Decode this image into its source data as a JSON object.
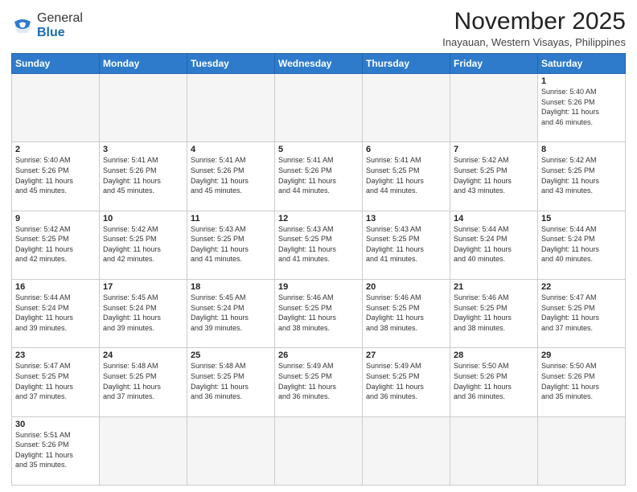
{
  "header": {
    "logo": {
      "general": "General",
      "blue": "Blue"
    },
    "title": "November 2025",
    "location": "Inayauan, Western Visayas, Philippines"
  },
  "days_of_week": [
    "Sunday",
    "Monday",
    "Tuesday",
    "Wednesday",
    "Thursday",
    "Friday",
    "Saturday"
  ],
  "weeks": [
    [
      {
        "day": null,
        "info": null
      },
      {
        "day": null,
        "info": null
      },
      {
        "day": null,
        "info": null
      },
      {
        "day": null,
        "info": null
      },
      {
        "day": null,
        "info": null
      },
      {
        "day": null,
        "info": null
      },
      {
        "day": "1",
        "info": "Sunrise: 5:40 AM\nSunset: 5:26 PM\nDaylight: 11 hours\nand 46 minutes."
      }
    ],
    [
      {
        "day": "2",
        "info": "Sunrise: 5:40 AM\nSunset: 5:26 PM\nDaylight: 11 hours\nand 45 minutes."
      },
      {
        "day": "3",
        "info": "Sunrise: 5:41 AM\nSunset: 5:26 PM\nDaylight: 11 hours\nand 45 minutes."
      },
      {
        "day": "4",
        "info": "Sunrise: 5:41 AM\nSunset: 5:26 PM\nDaylight: 11 hours\nand 45 minutes."
      },
      {
        "day": "5",
        "info": "Sunrise: 5:41 AM\nSunset: 5:26 PM\nDaylight: 11 hours\nand 44 minutes."
      },
      {
        "day": "6",
        "info": "Sunrise: 5:41 AM\nSunset: 5:25 PM\nDaylight: 11 hours\nand 44 minutes."
      },
      {
        "day": "7",
        "info": "Sunrise: 5:42 AM\nSunset: 5:25 PM\nDaylight: 11 hours\nand 43 minutes."
      },
      {
        "day": "8",
        "info": "Sunrise: 5:42 AM\nSunset: 5:25 PM\nDaylight: 11 hours\nand 43 minutes."
      }
    ],
    [
      {
        "day": "9",
        "info": "Sunrise: 5:42 AM\nSunset: 5:25 PM\nDaylight: 11 hours\nand 42 minutes."
      },
      {
        "day": "10",
        "info": "Sunrise: 5:42 AM\nSunset: 5:25 PM\nDaylight: 11 hours\nand 42 minutes."
      },
      {
        "day": "11",
        "info": "Sunrise: 5:43 AM\nSunset: 5:25 PM\nDaylight: 11 hours\nand 41 minutes."
      },
      {
        "day": "12",
        "info": "Sunrise: 5:43 AM\nSunset: 5:25 PM\nDaylight: 11 hours\nand 41 minutes."
      },
      {
        "day": "13",
        "info": "Sunrise: 5:43 AM\nSunset: 5:25 PM\nDaylight: 11 hours\nand 41 minutes."
      },
      {
        "day": "14",
        "info": "Sunrise: 5:44 AM\nSunset: 5:24 PM\nDaylight: 11 hours\nand 40 minutes."
      },
      {
        "day": "15",
        "info": "Sunrise: 5:44 AM\nSunset: 5:24 PM\nDaylight: 11 hours\nand 40 minutes."
      }
    ],
    [
      {
        "day": "16",
        "info": "Sunrise: 5:44 AM\nSunset: 5:24 PM\nDaylight: 11 hours\nand 39 minutes."
      },
      {
        "day": "17",
        "info": "Sunrise: 5:45 AM\nSunset: 5:24 PM\nDaylight: 11 hours\nand 39 minutes."
      },
      {
        "day": "18",
        "info": "Sunrise: 5:45 AM\nSunset: 5:24 PM\nDaylight: 11 hours\nand 39 minutes."
      },
      {
        "day": "19",
        "info": "Sunrise: 5:46 AM\nSunset: 5:25 PM\nDaylight: 11 hours\nand 38 minutes."
      },
      {
        "day": "20",
        "info": "Sunrise: 5:46 AM\nSunset: 5:25 PM\nDaylight: 11 hours\nand 38 minutes."
      },
      {
        "day": "21",
        "info": "Sunrise: 5:46 AM\nSunset: 5:25 PM\nDaylight: 11 hours\nand 38 minutes."
      },
      {
        "day": "22",
        "info": "Sunrise: 5:47 AM\nSunset: 5:25 PM\nDaylight: 11 hours\nand 37 minutes."
      }
    ],
    [
      {
        "day": "23",
        "info": "Sunrise: 5:47 AM\nSunset: 5:25 PM\nDaylight: 11 hours\nand 37 minutes."
      },
      {
        "day": "24",
        "info": "Sunrise: 5:48 AM\nSunset: 5:25 PM\nDaylight: 11 hours\nand 37 minutes."
      },
      {
        "day": "25",
        "info": "Sunrise: 5:48 AM\nSunset: 5:25 PM\nDaylight: 11 hours\nand 36 minutes."
      },
      {
        "day": "26",
        "info": "Sunrise: 5:49 AM\nSunset: 5:25 PM\nDaylight: 11 hours\nand 36 minutes."
      },
      {
        "day": "27",
        "info": "Sunrise: 5:49 AM\nSunset: 5:25 PM\nDaylight: 11 hours\nand 36 minutes."
      },
      {
        "day": "28",
        "info": "Sunrise: 5:50 AM\nSunset: 5:26 PM\nDaylight: 11 hours\nand 36 minutes."
      },
      {
        "day": "29",
        "info": "Sunrise: 5:50 AM\nSunset: 5:26 PM\nDaylight: 11 hours\nand 35 minutes."
      }
    ],
    [
      {
        "day": "30",
        "info": "Sunrise: 5:51 AM\nSunset: 5:26 PM\nDaylight: 11 hours\nand 35 minutes."
      },
      {
        "day": null,
        "info": null
      },
      {
        "day": null,
        "info": null
      },
      {
        "day": null,
        "info": null
      },
      {
        "day": null,
        "info": null
      },
      {
        "day": null,
        "info": null
      },
      {
        "day": null,
        "info": null
      }
    ]
  ]
}
